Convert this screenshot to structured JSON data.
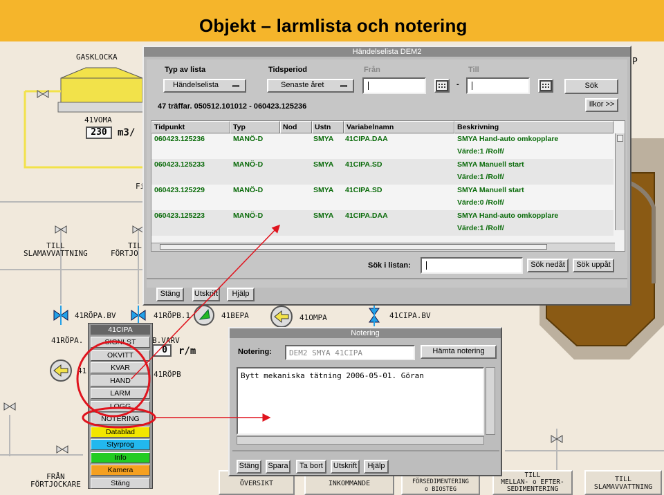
{
  "slide_title": "Objekt – larmlista och notering",
  "scada": {
    "gasklocka": "GASKLOCKA",
    "voma_tag": "41VOMA",
    "voma_value": "230",
    "voma_unit": "m3/",
    "till_slamavvattning": [
      "TILL",
      "SLAMAVVATTNING"
    ],
    "till_fortjo": [
      "TILL",
      "FÖRTJO"
    ],
    "fi": "Fi",
    "p": "P",
    "ropa_bv": "41RÖPA.BV",
    "ropb_partial": "41RÖPB.1",
    "bepa": "41BEPA",
    "ompa": "41OMPA",
    "cipa_bv": "41CIPA.BV",
    "ropa_partial": "41RÖPA.",
    "b_varv": "B.VARV",
    "varv_value": "0",
    "varv_unit": "r/m",
    "ropb": "41RÖPB",
    "num41a": "41",
    "fran_fortjockare": [
      "FRÅN",
      "FÖRTJOCKARE"
    ],
    "bottom_nav": [
      {
        "line1": "",
        "line2": "ÖVERSIKT"
      },
      {
        "line1": "",
        "line2": "INKOMMANDE"
      },
      {
        "line1": "FÖRSEDIMENTERING",
        "line2": "o BIOSTEG"
      },
      {
        "line1": "TILL",
        "line2": "MELLAN- o EFTER-",
        "line3": "SEDIMENTERING"
      },
      {
        "line1": "TILL",
        "line2": "SLAMAVVATTNING"
      }
    ]
  },
  "handelselista": {
    "title": "Händelselista DEM2",
    "typ_av_lista_label": "Typ av lista",
    "tidsperiod_label": "Tidsperiod",
    "fran_label": "Från",
    "till_label": "Till",
    "typ_value": "Händelselista",
    "period_value": "Senaste året",
    "fran_value": "",
    "dash": "-",
    "till_value": "",
    "sok_button": "Sök",
    "ilkor_button": "Ilkor >>",
    "summary": "47 träffar. 050512.101012 - 060423.125236",
    "columns": [
      "Tidpunkt",
      "Typ",
      "Nod",
      "Ustn",
      "Variabelnamn",
      "Beskrivning"
    ],
    "rows": [
      {
        "tid": "060423.125236",
        "typ": "MANÖ-D",
        "ustn": "SMYA",
        "var": "41CIPA.DAA",
        "besk1": "SMYA  Hand-auto omkopplare",
        "besk2": "Värde:1 /Rolf/"
      },
      {
        "tid": "060423.125233",
        "typ": "MANÖ-D",
        "ustn": "SMYA",
        "var": "41CIPA.SD",
        "besk1": "SMYA  Manuell start",
        "besk2": "Värde:1 /Rolf/"
      },
      {
        "tid": "060423.125229",
        "typ": "MANÖ-D",
        "ustn": "SMYA",
        "var": "41CIPA.SD",
        "besk1": "SMYA  Manuell start",
        "besk2": "Värde:0 /Rolf/"
      },
      {
        "tid": "060423.125223",
        "typ": "MANÖ-D",
        "ustn": "SMYA",
        "var": "41CIPA.DAA",
        "besk1": "SMYA  Hand-auto omkopplare",
        "besk2": "Värde:1 /Rolf/"
      }
    ],
    "sok_i_listan_label": "Sök i listan:",
    "sok_i_listan_value": "",
    "sok_nedat": "Sök nedåt",
    "sok_uppat": "Sök uppåt",
    "stang": "Stäng",
    "utskrift": "Utskrift",
    "hjalp": "Hjälp"
  },
  "objekt_menu": {
    "title": "41CIPA",
    "items": [
      {
        "label": "SIGNLST",
        "color": "#d6d6d6"
      },
      {
        "label": "OKVITT",
        "color": "#d6d6d6"
      },
      {
        "label": "KVAR",
        "color": "#d6d6d6"
      },
      {
        "label": "HAND",
        "color": "#d6d6d6"
      },
      {
        "label": "LARM",
        "color": "#d6d6d6"
      },
      {
        "label": "LOGG",
        "color": "#d6d6d6"
      },
      {
        "label": "NOTERING",
        "color": "#d6d6d6"
      },
      {
        "label": "Datablad",
        "color": "#f2e600"
      },
      {
        "label": "Styrprog",
        "color": "#22b8ee"
      },
      {
        "label": "Info",
        "color": "#22cc22"
      },
      {
        "label": "Kamera",
        "color": "#f5a020"
      },
      {
        "label": "Stäng",
        "color": "#d6d6d6"
      }
    ]
  },
  "notering": {
    "title": "Notering",
    "notering_label": "Notering:",
    "notering_value": "DEM2 SMYA 41CIPA",
    "hamta_button": "Hämta notering",
    "text": "Bytt mekaniska tätning 2006-05-01. Göran",
    "stang": "Stäng",
    "spara": "Spara",
    "ta_bort": "Ta bort",
    "utskrift": "Utskrift",
    "hjalp": "Hjälp"
  },
  "colors": {
    "title_bg": "#f5b52b",
    "annotation": "#e0141e",
    "row_text": "#0a6b0a",
    "tank_yellow": "#f2e24a",
    "sludge_brown": "#8a5a14"
  }
}
